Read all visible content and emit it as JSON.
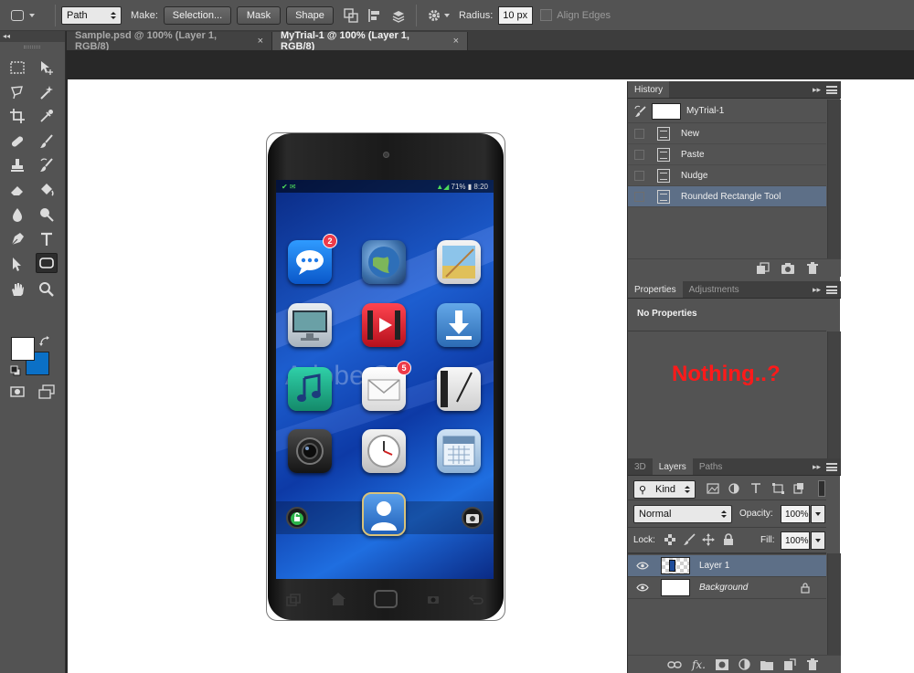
{
  "options_bar": {
    "path_mode": "Path",
    "make_label": "Make:",
    "selection_button": "Selection...",
    "mask_button": "Mask",
    "shape_button": "Shape",
    "radius_label": "Radius:",
    "radius_value": "10 px",
    "align_edges_label": "Align Edges"
  },
  "tabs": [
    {
      "title": "Sample.psd @ 100% (Layer 1, RGB/8)",
      "close": "×"
    },
    {
      "title": "MyTrial-1 @ 100% (Layer 1, RGB/8)",
      "close": "×"
    }
  ],
  "toolbar": {
    "collapse": "◂◂",
    "fg_color": "#ffffff",
    "bg_color": "#0b70c6"
  },
  "phone": {
    "status_time": "8:20",
    "status_battery": "71%",
    "watermark": "Adobe St",
    "badges": {
      "messages": "2",
      "mail": "5"
    }
  },
  "history": {
    "tab": "History",
    "snapshot": "MyTrial-1",
    "states": [
      "New",
      "Paste",
      "Nudge",
      "Rounded Rectangle Tool"
    ]
  },
  "properties": {
    "tabs": [
      "Properties",
      "Adjustments"
    ],
    "heading": "No Properties",
    "annotation": "Nothing..?",
    "annotation_color": "#ff1a1a"
  },
  "layers": {
    "tabs": [
      "3D",
      "Layers",
      "Paths"
    ],
    "filter_kind": "Kind",
    "blend_mode": "Normal",
    "opacity_label": "Opacity:",
    "opacity_value": "100%",
    "lock_label": "Lock:",
    "fill_label": "Fill:",
    "fill_value": "100%",
    "items": [
      "Layer 1",
      "Background"
    ],
    "footer_fx": "fx."
  },
  "accent_selection": "#5d6f87"
}
